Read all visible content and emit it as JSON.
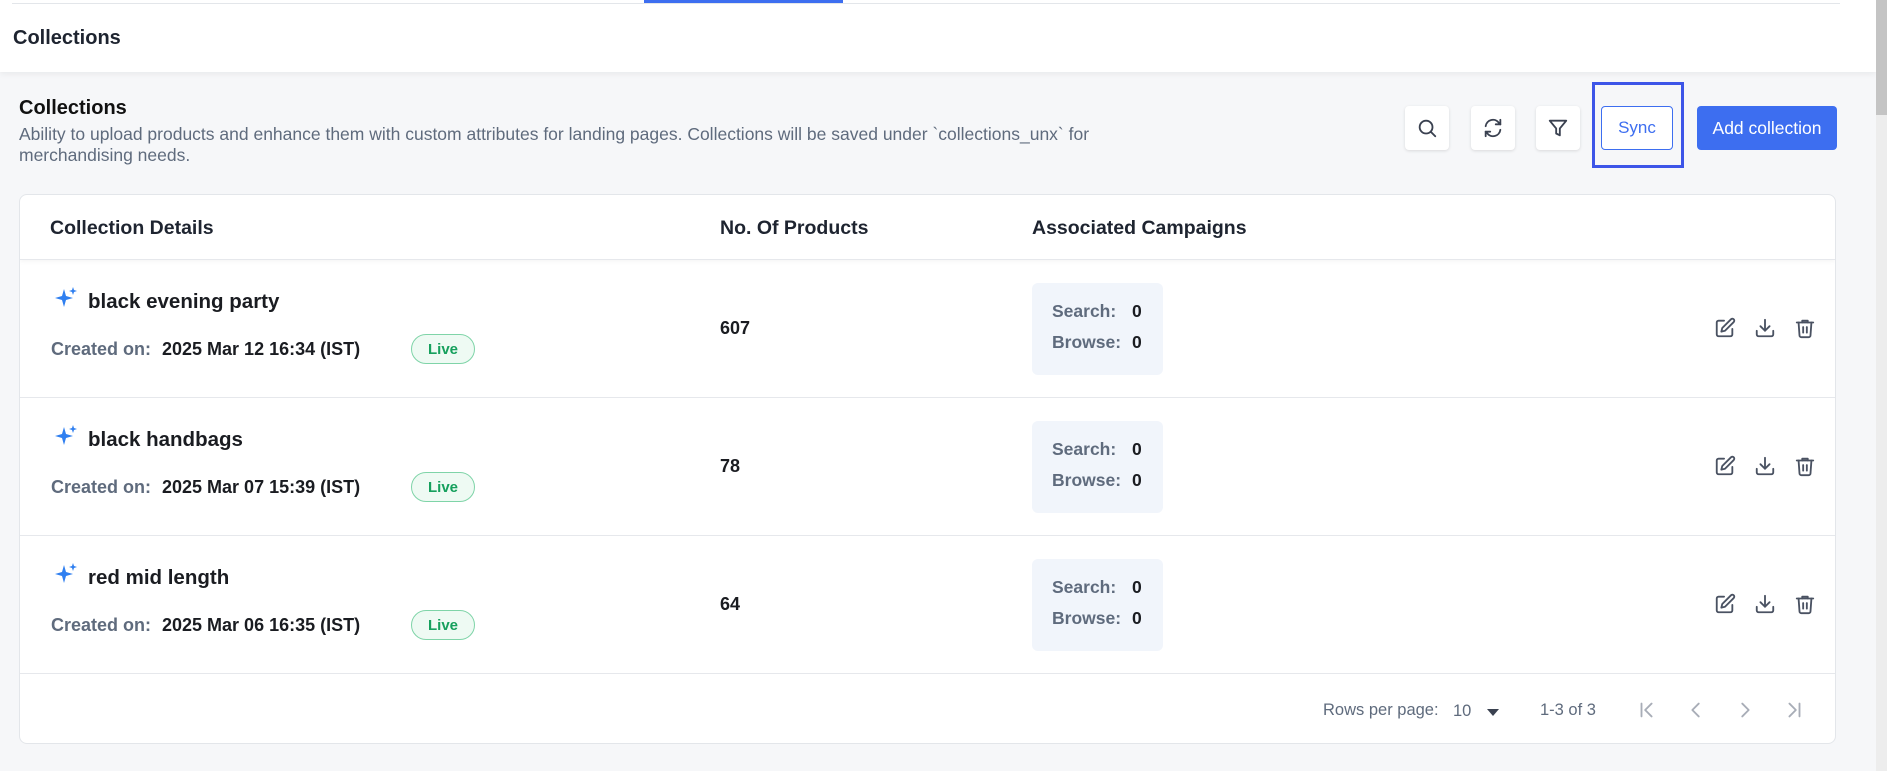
{
  "header": {
    "breadcrumb": "Collections"
  },
  "section": {
    "title": "Collections",
    "description": "Ability to upload products and enhance them with custom attributes for landing pages. Collections will be saved under `collections_unx` for merchandising needs."
  },
  "toolbar": {
    "search_icon": "search-icon",
    "refresh_icon": "refresh-icon",
    "filter_icon": "filter-icon",
    "sync_label": "Sync",
    "add_label": "Add collection"
  },
  "table": {
    "columns": [
      "Collection Details",
      "No. Of Products",
      "Associated Campaigns"
    ],
    "created_label": "Created on:",
    "search_label": "Search:",
    "browse_label": "Browse:",
    "rows": [
      {
        "name": "black evening party",
        "created": "2025 Mar 12 16:34 (IST)",
        "status": "Live",
        "products": "607",
        "search": "0",
        "browse": "0"
      },
      {
        "name": "black handbags",
        "created": "2025 Mar 07 15:39 (IST)",
        "status": "Live",
        "products": "78",
        "search": "0",
        "browse": "0"
      },
      {
        "name": "red mid length",
        "created": "2025 Mar 06 16:35 (IST)",
        "status": "Live",
        "products": "64",
        "search": "0",
        "browse": "0"
      }
    ]
  },
  "pagination": {
    "rows_per_page_label": "Rows per page:",
    "rows_per_page_value": "10",
    "range": "1-3 of 3"
  },
  "colors": {
    "accent": "#3d6ef0",
    "live_green": "#16a05d",
    "highlight_frame": "#3d55e8"
  }
}
